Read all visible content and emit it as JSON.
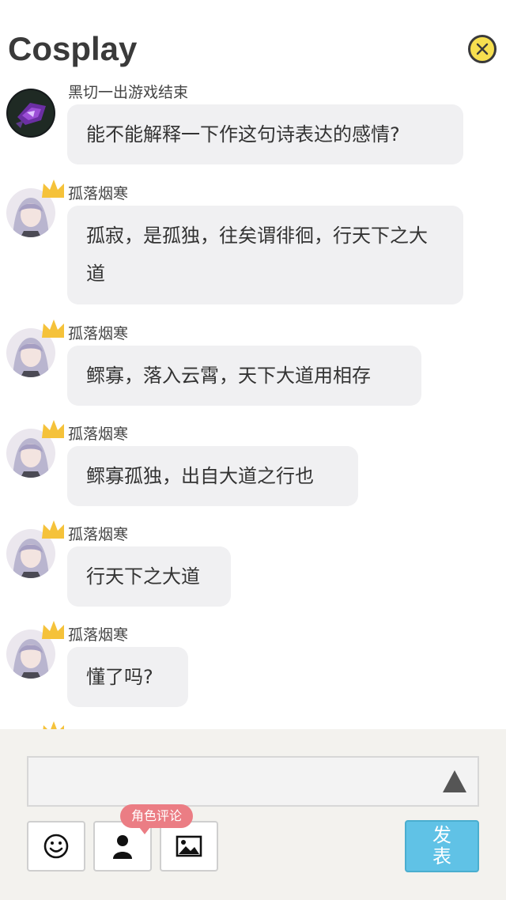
{
  "header": {
    "title": "Cosplay"
  },
  "messages": [
    {
      "name": "黑切一出游戏结束",
      "text": "能不能解释一下作这句诗表达的感情?",
      "avatar": "dark-avatar",
      "crown": false
    },
    {
      "name": "孤落烟寒",
      "text": "孤寂，是孤独，往矣谓徘徊，行天下之大道",
      "avatar": "anime-girl-avatar",
      "crown": true
    },
    {
      "name": "孤落烟寒",
      "text": "鳏寡，落入云霄，天下大道用相存",
      "avatar": "anime-girl-avatar",
      "crown": true
    },
    {
      "name": "孤落烟寒",
      "text": "鳏寡孤独，出自大道之行也",
      "avatar": "anime-girl-avatar",
      "crown": true
    },
    {
      "name": "孤落烟寒",
      "text": "行天下之大道",
      "avatar": "anime-girl-avatar",
      "crown": true
    },
    {
      "name": "孤落烟寒",
      "text": "懂了吗?",
      "avatar": "anime-girl-avatar",
      "crown": true
    }
  ],
  "composer": {
    "role_tag": "角色评论",
    "publish_line1": "发",
    "publish_line2": "表",
    "tools": [
      "emoji-icon",
      "person-icon",
      "image-icon"
    ]
  },
  "colors": {
    "bubble": "#f0f0f2",
    "publish": "#60c2e6",
    "role_tag": "#eb7d84",
    "close": "#f6df4f",
    "crown": "#f5c23a"
  }
}
